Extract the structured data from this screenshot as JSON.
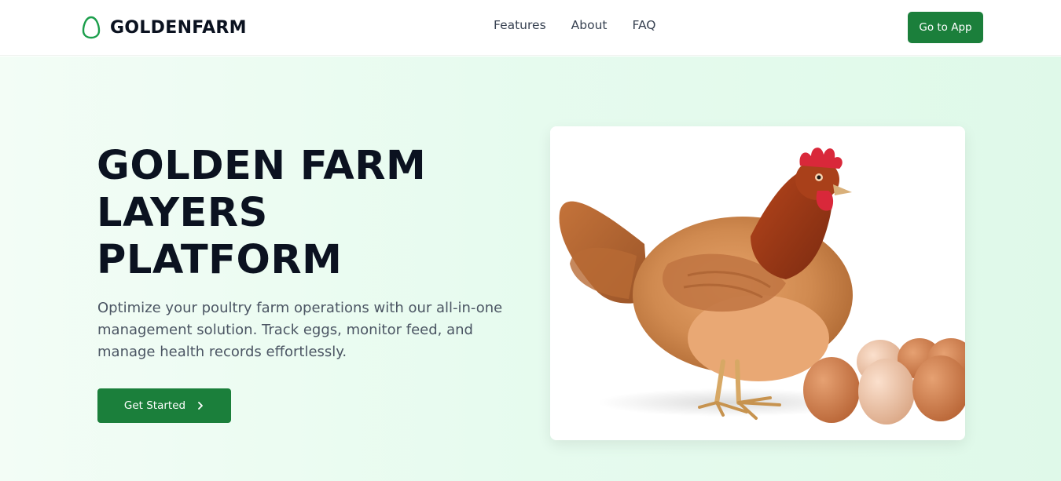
{
  "brand": {
    "name": "GOLDENFARM",
    "accent": "#1b7f3b",
    "logo_icon": "egg-icon"
  },
  "nav": {
    "items": [
      {
        "label": "Features"
      },
      {
        "label": "About"
      },
      {
        "label": "FAQ"
      }
    ],
    "cta_label": "Go to App"
  },
  "hero": {
    "title_lines": [
      "GOLDEN FARM",
      "LAYERS",
      "PLATFORM"
    ],
    "subtitle": "Optimize your poultry farm operations with our all-in-one management solution. Track eggs, monitor feed, and manage health records effortlessly.",
    "cta_label": "Get Started",
    "cta_icon": "chevron-right-icon",
    "image_icon": "hen-with-eggs-illustration"
  }
}
